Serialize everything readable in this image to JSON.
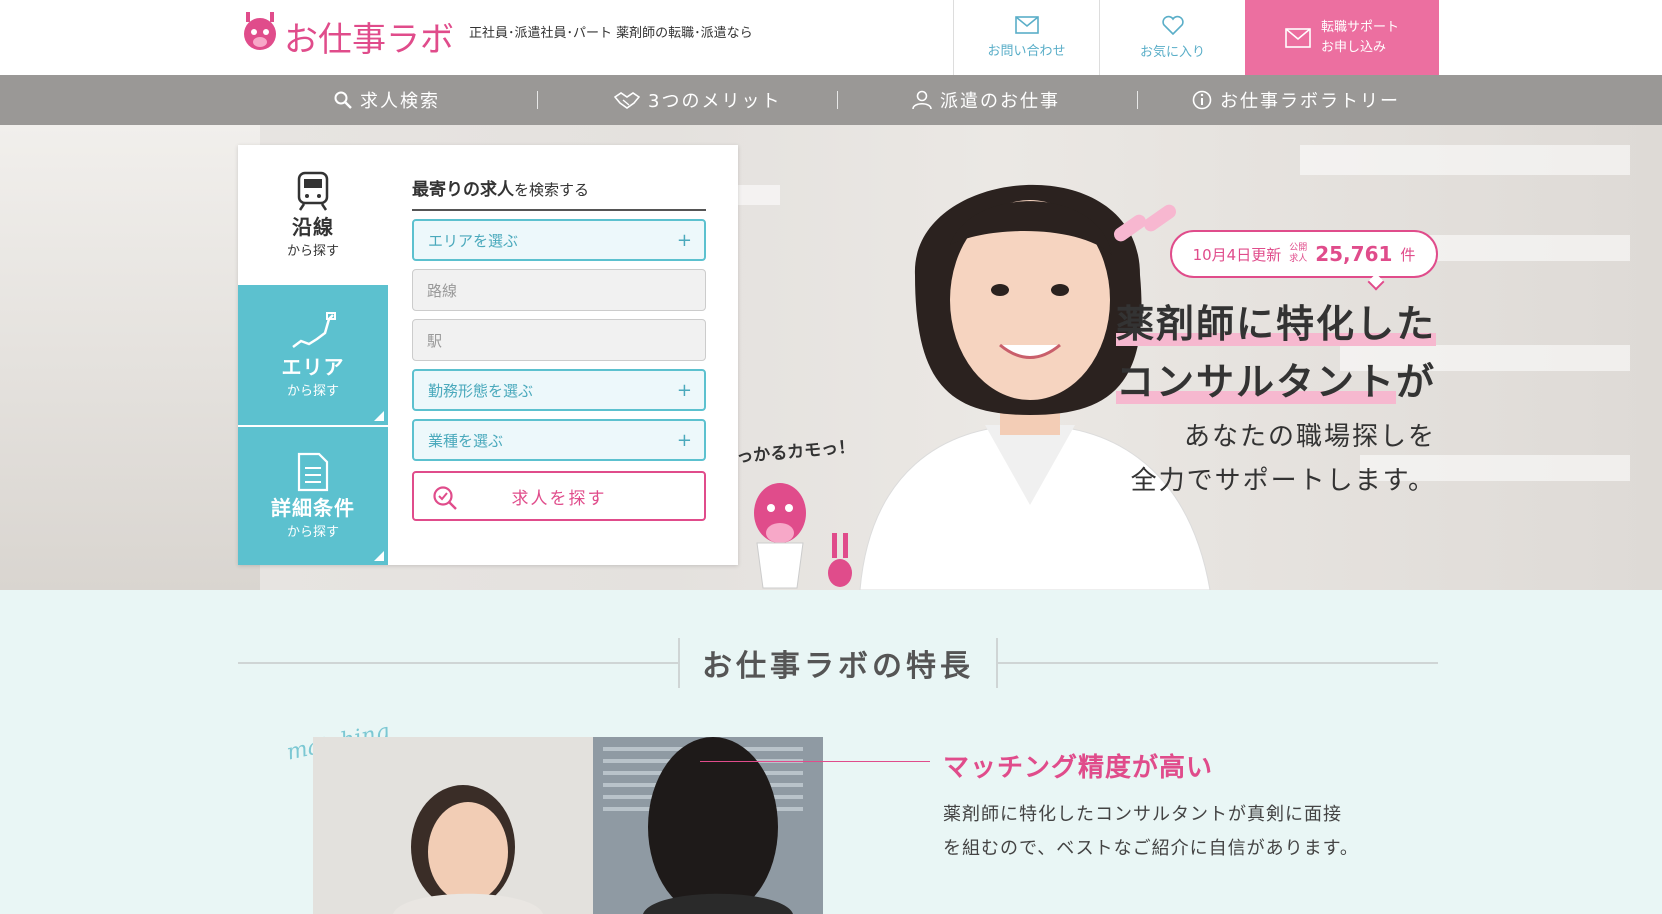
{
  "header": {
    "logo_text": "お仕事ラボ",
    "tagline": "正社員･派遣社員･パート 薬剤師の転職･派遣なら",
    "contact_label": "お問い合わせ",
    "favorite_label": "お気に入り",
    "support_line1": "転職サポート",
    "support_line2": "お申し込み"
  },
  "nav": {
    "items": [
      {
        "label": "求人検索",
        "icon": "search-icon"
      },
      {
        "label": "3つのメリット",
        "icon": "handshake-icon"
      },
      {
        "label": "派遣のお仕事",
        "icon": "person-icon"
      },
      {
        "label": "お仕事ラボラトリー",
        "icon": "info-icon"
      }
    ]
  },
  "search": {
    "tabs": [
      {
        "title": "沿線",
        "sub": "から探す",
        "icon": "train-icon"
      },
      {
        "title": "エリア",
        "sub": "から探す",
        "icon": "map-icon"
      },
      {
        "title": "詳細条件",
        "sub": "から探す",
        "icon": "checklist-icon"
      }
    ],
    "title_bold": "最寄りの求人",
    "title_rest": "を検索する",
    "fields": {
      "area": "エリアを選ぶ",
      "line": "路線",
      "station": "駅",
      "employment": "勤務形態を選ぶ",
      "job_type": "業種を選ぶ"
    },
    "button_label": "求人を探す"
  },
  "hero": {
    "update": "10月4日更新",
    "public_label_1": "公開",
    "public_label_2": "求人",
    "count": "25,761",
    "count_unit": "件",
    "headline_1": "薬剤師に特化した",
    "headline_2a": "コンサルタント",
    "headline_2b": "が",
    "sub_1": "あなたの職場探しを",
    "sub_2": "全力でサポートします。",
    "mascot_text": "見っかるカモっ！"
  },
  "features": {
    "title": "お仕事ラボの特長",
    "matching": "matching",
    "heading": "マッチング精度が高い",
    "text_1": "薬剤師に特化したコンサルタントが真剣に面接",
    "text_2": "を組むので、ベストなご紹介に自信があります。"
  },
  "colors": {
    "pink": "#e04c8b",
    "teal": "#5cc1cf",
    "nav_gray": "#9a9896",
    "feature_bg": "#e9f6f5"
  }
}
